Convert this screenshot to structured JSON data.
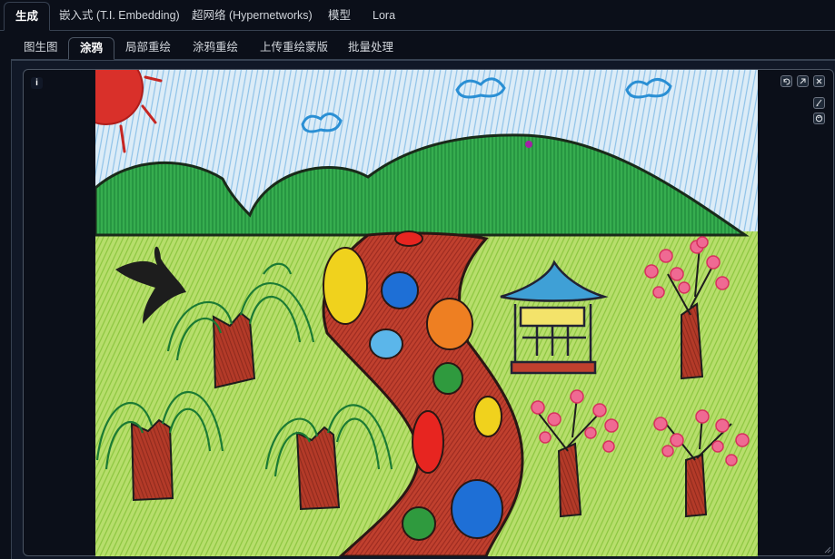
{
  "top_tabs": [
    {
      "label": "生成",
      "active": true
    },
    {
      "label": "嵌入式 (T.I. Embedding)",
      "active": false
    },
    {
      "label": "超网络 (Hypernetworks)",
      "active": false
    },
    {
      "label": "模型",
      "active": false
    },
    {
      "label": "Lora",
      "active": false
    }
  ],
  "sub_tabs": [
    {
      "label": "图生图",
      "active": false
    },
    {
      "label": "涂鸦",
      "active": true
    },
    {
      "label": "局部重绘",
      "active": false
    },
    {
      "label": "涂鸦重绘",
      "active": false
    },
    {
      "label": "上传重绘蒙版",
      "active": false
    },
    {
      "label": "批量处理",
      "active": false
    }
  ],
  "canvas": {
    "info_label": "i",
    "image_description_icon": "child-crayon-drawing-image",
    "tools": [
      "undo-icon",
      "clear-icon",
      "close-icon",
      "brush-icon",
      "color-palette-icon"
    ]
  },
  "colors": {
    "background": "#0b0f19",
    "panel": "#111827",
    "border": "#374151",
    "sky": "#cfe6f5",
    "grass": "#a8d85a",
    "hill": "#2fa64a",
    "path": "#b8382a"
  }
}
